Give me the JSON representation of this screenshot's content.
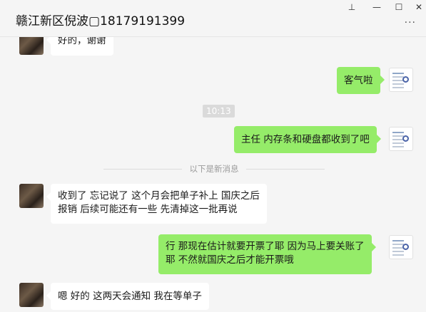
{
  "window": {
    "title": "赣江新区倪波▢18179191399",
    "pin_icon": "pin-icon",
    "minimize_icon": "minimize-icon",
    "maximize_icon": "maximize-icon",
    "close_icon": "close-icon",
    "more_icon": "more-icon",
    "pin_glyph": "⊥",
    "minimize_glyph": "—",
    "maximize_glyph": "☐",
    "close_glyph": "✕",
    "more_glyph": "···"
  },
  "messages": [
    {
      "side": "in",
      "text": "好的，谢谢"
    },
    {
      "side": "out",
      "text": "客气啦"
    },
    {
      "side": "out",
      "text": "主任 内存条和硬盘都收到了吧"
    },
    {
      "side": "in",
      "line1": "收到了 忘记说了 这个月会把单子补上 国庆之后",
      "line2": "报销 后续可能还有一些 先清掉这一批再说"
    },
    {
      "side": "out",
      "line1": "行  那现在估计就要开票了耶 因为马上要关账了",
      "line2": "耶  不然就国庆之后才能开票哦"
    },
    {
      "side": "in",
      "text": "嗯 好的 这两天会通知 我在等单子"
    }
  ],
  "timestamp": "10:13",
  "new_messages_divider": "以下是新消息",
  "colors": {
    "outgoing_bubble": "#95ec69",
    "incoming_bubble": "#ffffff",
    "background": "#f5f5f5"
  }
}
